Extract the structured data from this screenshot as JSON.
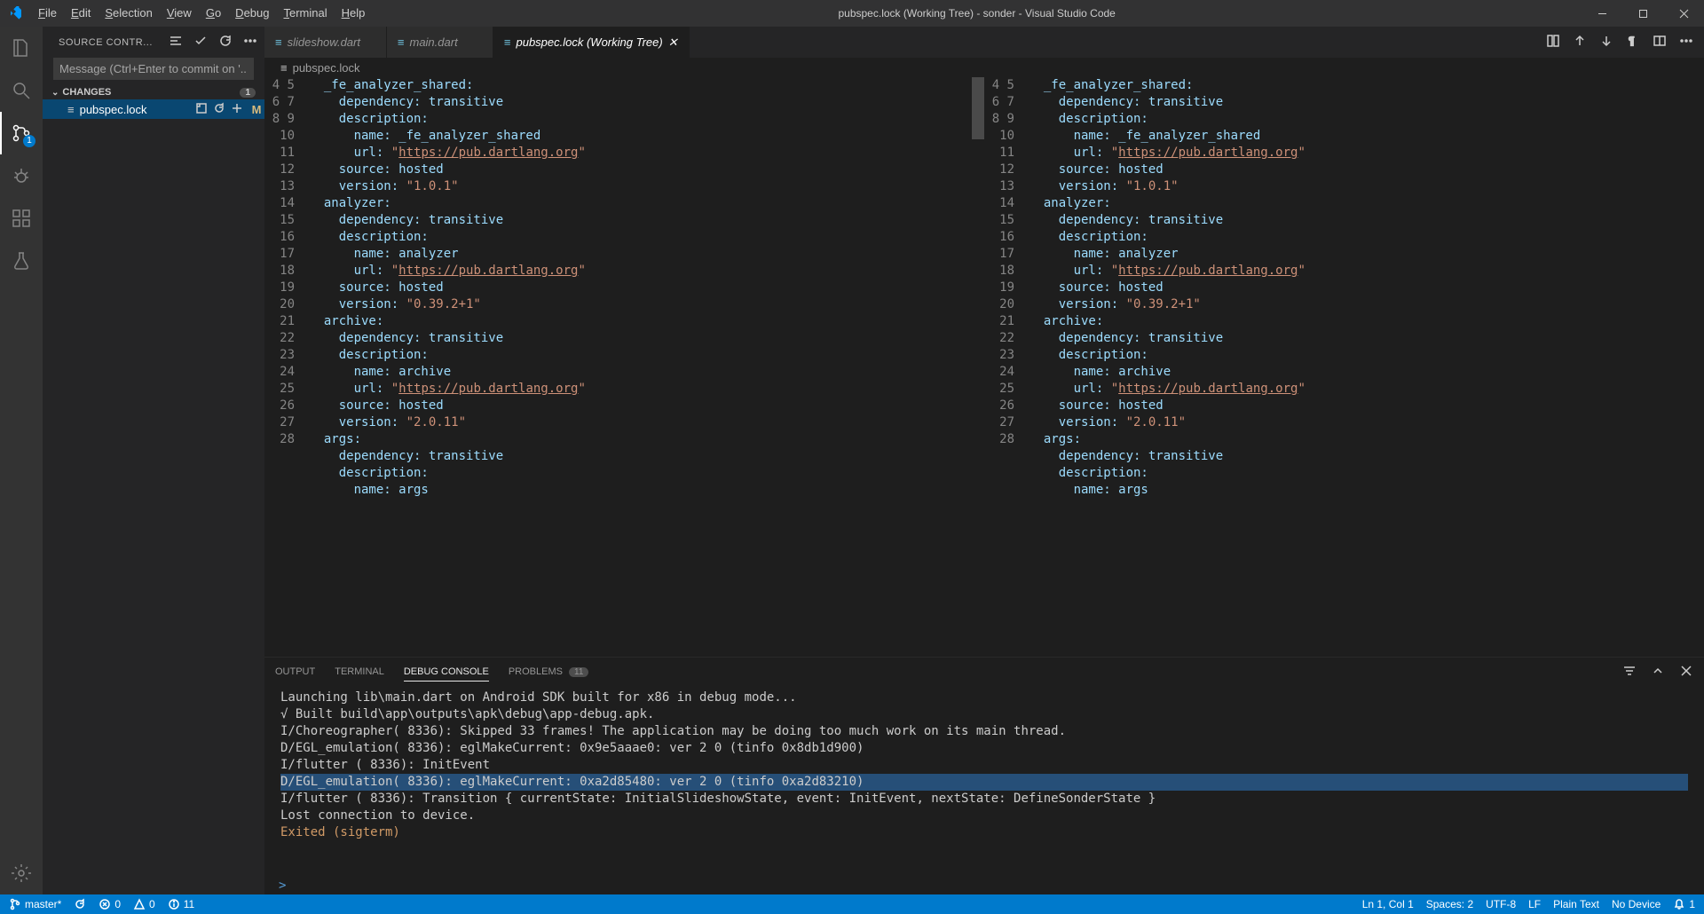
{
  "window": {
    "title": "pubspec.lock (Working Tree) - sonder - Visual Studio Code"
  },
  "menu": [
    "File",
    "Edit",
    "Selection",
    "View",
    "Go",
    "Debug",
    "Terminal",
    "Help"
  ],
  "activity": {
    "scm_badge": "1"
  },
  "sidebar": {
    "title": "SOURCE CONTR...",
    "commit_placeholder": "Message (Ctrl+Enter to commit on '...",
    "changes_label": "CHANGES",
    "changes_count": "1",
    "file": {
      "name": "pubspec.lock",
      "status": "M"
    }
  },
  "tabs": [
    {
      "label": "slideshow.dart"
    },
    {
      "label": "main.dart"
    },
    {
      "label": "pubspec.lock (Working Tree)",
      "active": true
    }
  ],
  "breadcrumb": {
    "file": "pubspec.lock"
  },
  "code_lines": [
    {
      "n": 4,
      "t": "  _fe_analyzer_shared:"
    },
    {
      "n": 5,
      "t": "    dependency: transitive"
    },
    {
      "n": 6,
      "t": "    description:"
    },
    {
      "n": 7,
      "t": "      name: _fe_analyzer_shared"
    },
    {
      "n": 8,
      "t": "      url: ",
      "url": "\"https://pub.dartlang.org\""
    },
    {
      "n": 9,
      "t": "    source: hosted"
    },
    {
      "n": 10,
      "t": "    version: ",
      "s": "\"1.0.1\""
    },
    {
      "n": 11,
      "t": "  analyzer:"
    },
    {
      "n": 12,
      "t": "    dependency: transitive"
    },
    {
      "n": 13,
      "t": "    description:"
    },
    {
      "n": 14,
      "t": "      name: analyzer"
    },
    {
      "n": 15,
      "t": "      url: ",
      "url": "\"https://pub.dartlang.org\""
    },
    {
      "n": 16,
      "t": "    source: hosted"
    },
    {
      "n": 17,
      "t": "    version: ",
      "s": "\"0.39.2+1\""
    },
    {
      "n": 18,
      "t": "  archive:"
    },
    {
      "n": 19,
      "t": "    dependency: transitive"
    },
    {
      "n": 20,
      "t": "    description:"
    },
    {
      "n": 21,
      "t": "      name: archive"
    },
    {
      "n": 22,
      "t": "      url: ",
      "url": "\"https://pub.dartlang.org\""
    },
    {
      "n": 23,
      "t": "    source: hosted"
    },
    {
      "n": 24,
      "t": "    version: ",
      "s": "\"2.0.11\""
    },
    {
      "n": 25,
      "t": "  args:"
    },
    {
      "n": 26,
      "t": "    dependency: transitive"
    },
    {
      "n": 27,
      "t": "    description:"
    },
    {
      "n": 28,
      "t": "      name: args"
    }
  ],
  "panel": {
    "tabs": {
      "output": "OUTPUT",
      "terminal": "TERMINAL",
      "debug": "DEBUG CONSOLE",
      "problems": "PROBLEMS",
      "problems_count": "11"
    },
    "lines": [
      {
        "t": "Launching lib\\main.dart on Android SDK built for x86 in debug mode..."
      },
      {
        "t": "√ Built build\\app\\outputs\\apk\\debug\\app-debug.apk."
      },
      {
        "t": "I/Choreographer( 8336): Skipped 33 frames!  The application may be doing too much work on its main thread."
      },
      {
        "t": "D/EGL_emulation( 8336): eglMakeCurrent: 0x9e5aaae0: ver 2 0 (tinfo 0x8db1d900)"
      },
      {
        "t": "I/flutter ( 8336): InitEvent"
      },
      {
        "t": "D/EGL_emulation( 8336): eglMakeCurrent: 0xa2d85480: ver 2 0 (tinfo 0xa2d83210)",
        "sel": true
      },
      {
        "t": "I/flutter ( 8336): Transition { currentState: InitialSlideshowState, event: InitEvent, nextState: DefineSonderState }"
      },
      {
        "t": "Lost connection to device."
      },
      {
        "t": "Exited (sigterm)",
        "exit": true
      }
    ],
    "prompt": ">"
  },
  "status": {
    "branch": "master*",
    "errors": "0",
    "warnings": "0",
    "info": "11",
    "ln_col": "Ln 1, Col 1",
    "spaces": "Spaces: 2",
    "encoding": "UTF-8",
    "eol": "LF",
    "lang": "Plain Text",
    "device": "No Device",
    "bell": "1"
  }
}
